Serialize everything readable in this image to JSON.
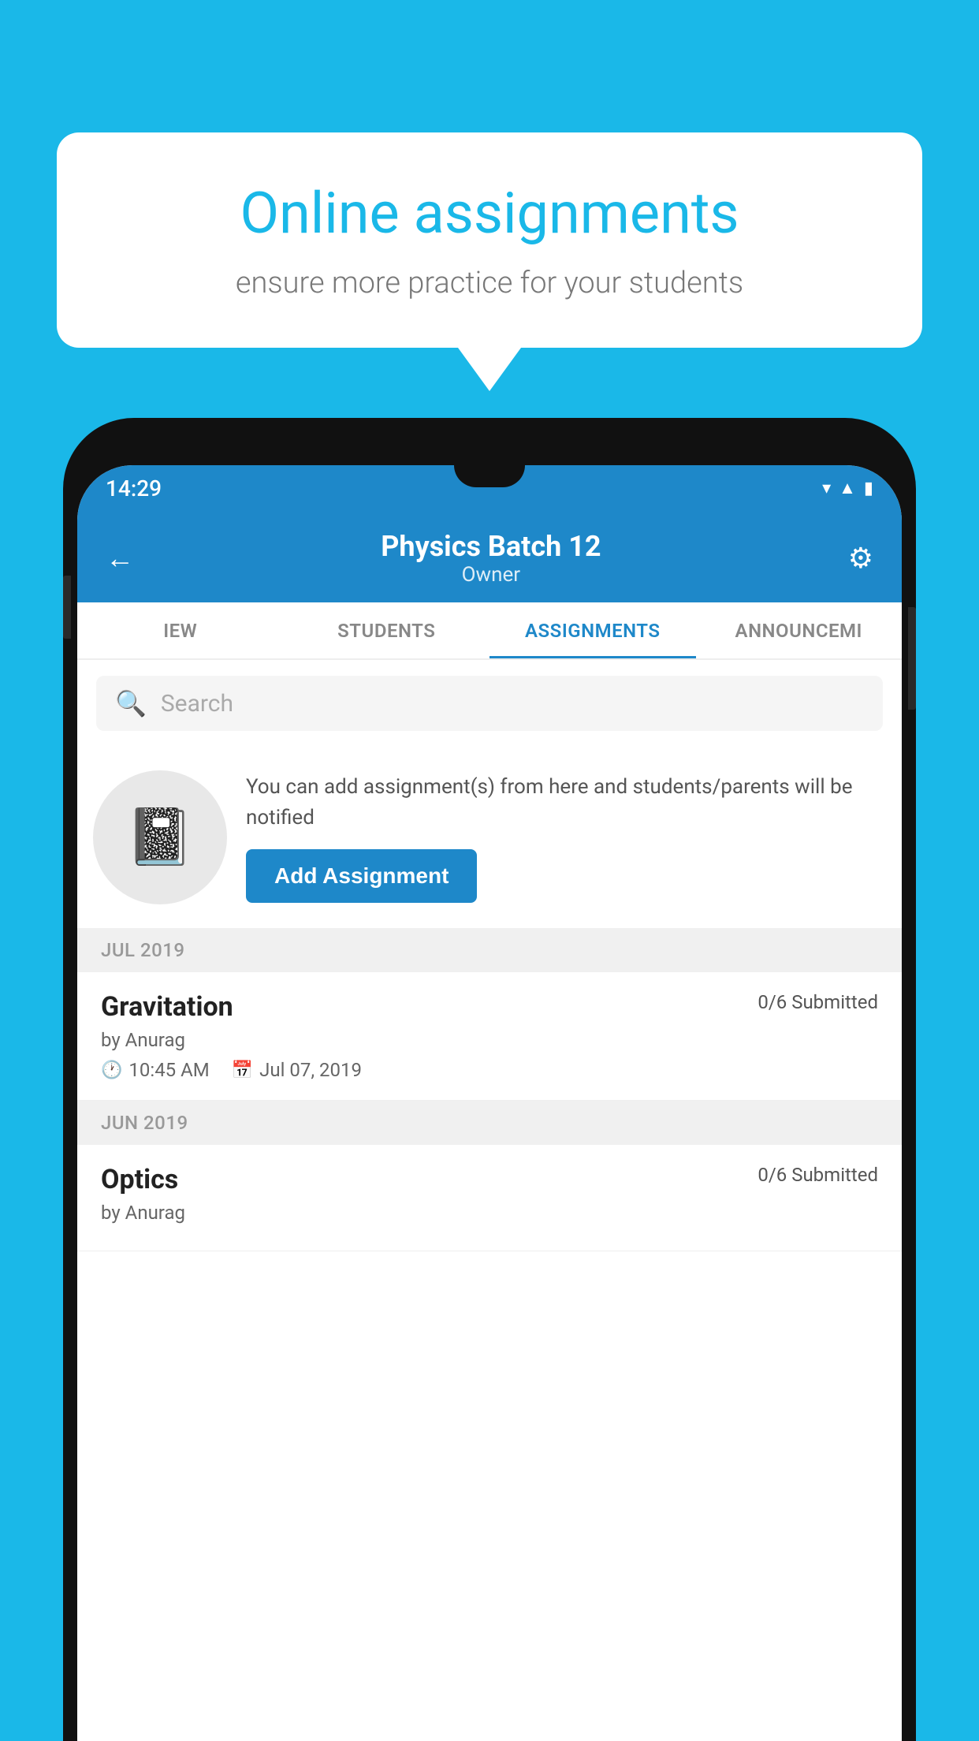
{
  "background_color": "#1ab8e8",
  "speech_bubble": {
    "title": "Online assignments",
    "subtitle": "ensure more practice for your students"
  },
  "phone": {
    "status_bar": {
      "time": "14:29",
      "icons": [
        "wifi",
        "signal",
        "battery"
      ]
    },
    "header": {
      "title": "Physics Batch 12",
      "subtitle": "Owner"
    },
    "tabs": [
      {
        "label": "IEW",
        "active": false
      },
      {
        "label": "STUDENTS",
        "active": false
      },
      {
        "label": "ASSIGNMENTS",
        "active": true
      },
      {
        "label": "ANNOUNCEMI",
        "active": false
      }
    ],
    "search": {
      "placeholder": "Search"
    },
    "promo": {
      "text": "You can add assignment(s) from here and students/parents will be notified",
      "button_label": "Add Assignment"
    },
    "sections": [
      {
        "month_label": "JUL 2019",
        "assignments": [
          {
            "name": "Gravitation",
            "submitted": "0/6 Submitted",
            "author": "by Anurag",
            "time": "10:45 AM",
            "date": "Jul 07, 2019"
          }
        ]
      },
      {
        "month_label": "JUN 2019",
        "assignments": [
          {
            "name": "Optics",
            "submitted": "0/6 Submitted",
            "author": "by Anurag",
            "time": "",
            "date": ""
          }
        ]
      }
    ]
  }
}
